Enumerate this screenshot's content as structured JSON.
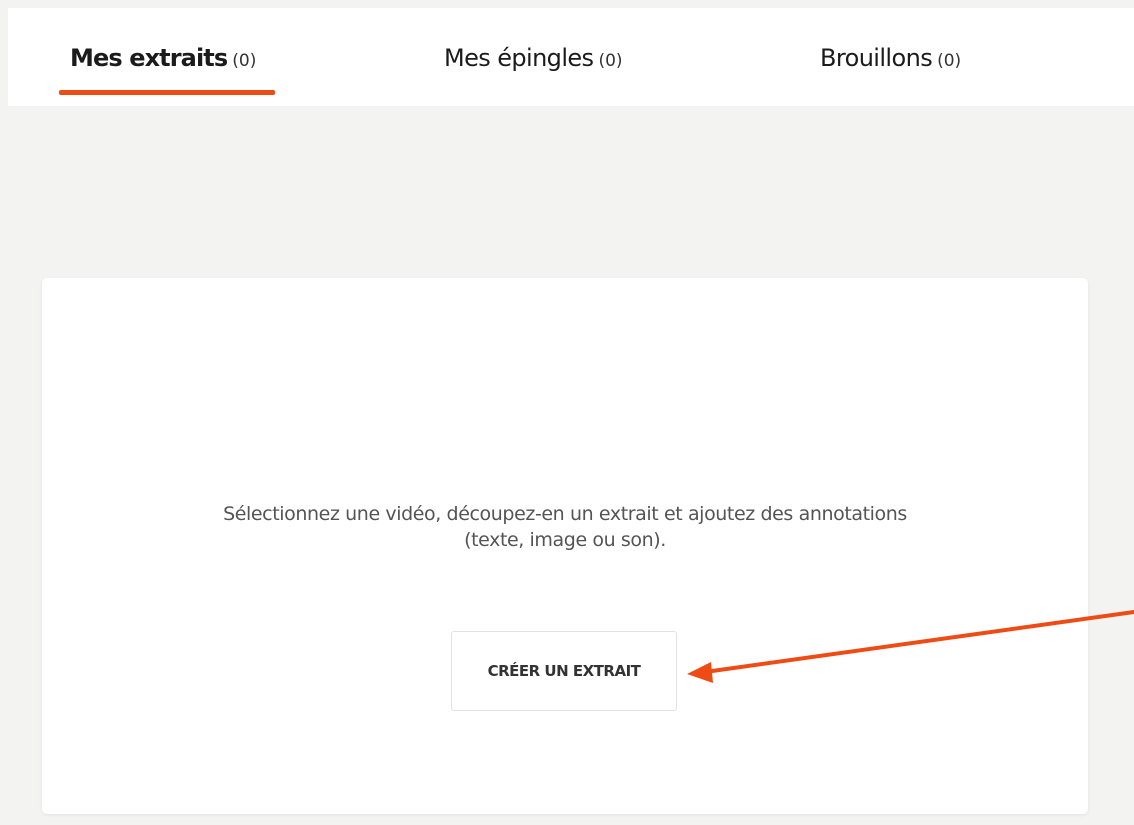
{
  "tabs": [
    {
      "label": "Mes extraits",
      "count": "(0)",
      "active": true
    },
    {
      "label": "Mes épingles",
      "count": "(0)",
      "active": false
    },
    {
      "label": "Brouillons",
      "count": "(0)",
      "active": false
    }
  ],
  "empty_state": {
    "line1": "Sélectionnez une vidéo, découpez-en un extrait et ajoutez des annotations",
    "line2": "(texte, image ou son).",
    "button_label": "CRÉER UN EXTRAIT"
  },
  "colors": {
    "accent": "#ee4b15",
    "annotation_arrow": "#ee4b15",
    "background": "#f3f3f1"
  },
  "annotation": {
    "arrow_icon": "arrow-left-icon"
  }
}
